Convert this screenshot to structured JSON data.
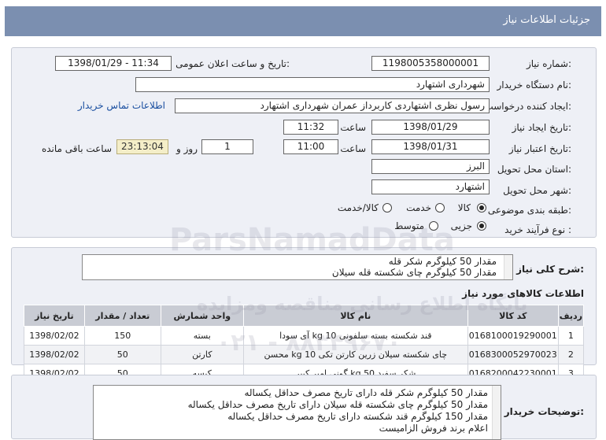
{
  "title": "جزئیات اطلاعات نیاز",
  "fields": {
    "need_number_label": "شماره نیاز:",
    "need_number": "1198005358000001",
    "announce_label": "تاریخ و ساعت اعلان عمومی:",
    "announce_value": "1398/01/29 - 11:34",
    "buyer_org_label": "نام دستگاه خریدار:",
    "buyer_org": "شهرداری اشتهارد",
    "creator_label": "ایجاد کننده درخواست:",
    "creator": "رسول نظری اشتهاردی کاربرداز عمران شهرداری اشتهارد",
    "contact_link": "اطلاعات تماس خریدار",
    "created_date_label": "تاریخ ایجاد نیاز:",
    "created_date": "1398/01/29",
    "time_label": "ساعت",
    "created_time": "11:32",
    "valid_date_label": "تاریخ اعتبار نیاز:",
    "valid_date": "1398/01/31",
    "valid_time": "11:00",
    "days_value": "1",
    "days_label": "روز و",
    "remaining_value": "23:13:04",
    "remaining_label": "ساعت باقی مانده",
    "province_label": "استان محل تحویل:",
    "province": "البرز",
    "city_label": "شهر محل تحویل:",
    "city": "اشتهارد",
    "category_label": "طبقه بندی موضوعی:",
    "category_options": [
      "کالا",
      "خدمت",
      "کالا/خدمت"
    ],
    "process_label": "نوع فرآیند خرید :",
    "process_options": [
      "جزیی",
      "متوسط"
    ]
  },
  "summary": {
    "label": "شرح کلی نیاز:",
    "lines": [
      "مقدار 50 کیلوگرم شکر قله",
      "مقدار 50 کیلوگرم چای شکسته قله سیلان"
    ]
  },
  "goods": {
    "title": "اطلاعات کالاهای مورد نیاز",
    "columns": [
      "ردیف",
      "کد کالا",
      "نام کالا",
      "واحد شمارش",
      "تعداد / مقدار",
      "تاریخ نیاز"
    ],
    "rows": [
      [
        "1",
        "0168100019290001",
        "قند شکسته بسته سلفونی 10 kg آی سودا",
        "بسته",
        "150",
        "1398/02/02"
      ],
      [
        "2",
        "0168300052970023",
        "چای شکسته سیلان زرین کارتن تکی 10 kg محسن",
        "کارتن",
        "50",
        "1398/02/02"
      ],
      [
        "3",
        "0168200042230001",
        "شکر سفید 50 kg گونی امیر کبیر",
        "کیسه",
        "50",
        "1398/02/02"
      ]
    ]
  },
  "buyer_notes": {
    "label": "توضیحات خریدار:",
    "lines": [
      "مقدار 50 کیلوگرم شکر قله دارای تاریخ مصرف حداقل یکساله",
      "مقدار 50 کیلوگرم چای شکسته قله سیلان دارای تاریخ مصرف حداقل یکساله",
      "مقدار 150 کیلوگرم قند شکسته  دارای تاریخ مصرف حداقل یکساله",
      "اعلام برند فروش الزامیست"
    ]
  },
  "watermark": {
    "line1": "ParsNamadData",
    "line2": "پایگاه اطلاع رسانی مناقصه ومزایده",
    "line3": "۰۲۱ - ۸۸۳۴۹۶۷۰"
  }
}
